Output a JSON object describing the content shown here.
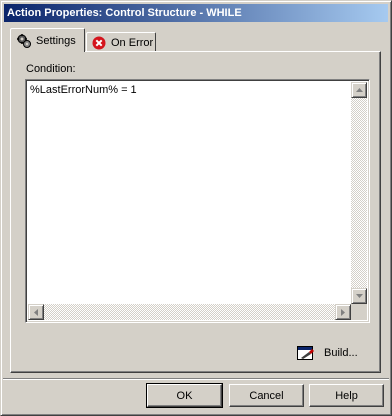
{
  "window": {
    "title": "Action Properties: Control Structure - WHILE"
  },
  "tabs": [
    {
      "label": "Settings",
      "icon": "gears-icon"
    },
    {
      "label": "On Error",
      "icon": "error-icon"
    }
  ],
  "settings": {
    "condition_label": "Condition:",
    "condition_value": "%LastErrorNum% = 1"
  },
  "build": {
    "label": "Build...",
    "icon": "build-icon"
  },
  "buttons": {
    "ok": "OK",
    "cancel": "Cancel",
    "help": "Help"
  },
  "colors": {
    "title_start": "#0a246a",
    "title_end": "#a6caf0",
    "error": "#d4141c",
    "face": "#d4d0c8"
  }
}
